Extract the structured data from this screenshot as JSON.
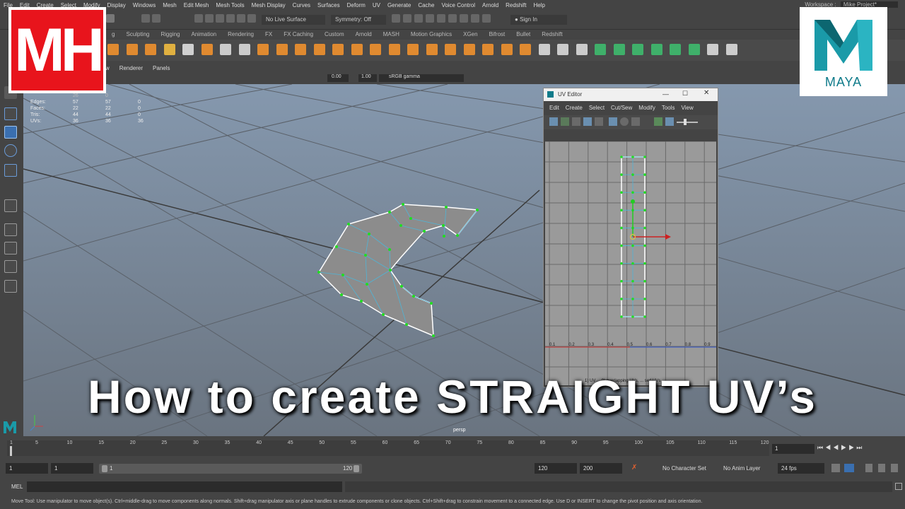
{
  "menubar": {
    "items": [
      "File",
      "Edit",
      "Create",
      "Select",
      "Modify",
      "Display",
      "Windows",
      "Mesh",
      "Edit Mesh",
      "Mesh Tools",
      "Mesh Display",
      "Curves",
      "Surfaces",
      "Deform",
      "UV",
      "Generate",
      "Cache",
      "Voice Control",
      "Arnold",
      "Redshift",
      "Help"
    ],
    "workspace_label": "Workspace :",
    "workspace_value": "Mike Project*"
  },
  "statusline": {
    "live_surface": "No Live Surface",
    "symmetry": "Symmetry: Off",
    "sign_in": "Sign In"
  },
  "shelf": {
    "tabs": [
      "g",
      "Sculpting",
      "Rigging",
      "Animation",
      "Rendering",
      "FX",
      "FX Caching",
      "Custom",
      "Arnold",
      "MASH",
      "Motion Graphics",
      "XGen",
      "Bifrost",
      "Bullet",
      "Redshift"
    ]
  },
  "panel": {
    "menu": [
      "how",
      "Renderer",
      "Panels"
    ],
    "camera_value_1": "0.00",
    "camera_value_2": "1.00",
    "color_space": "sRGB gamma",
    "camera_name": "persp"
  },
  "hud": {
    "rows": [
      {
        "label": "Edges:",
        "v1": "57",
        "v2": "57",
        "v3": "0"
      },
      {
        "label": "Faces:",
        "v1": "22",
        "v2": "22",
        "v3": "0"
      },
      {
        "label": "Tris:",
        "v1": "44",
        "v2": "44",
        "v3": "0"
      },
      {
        "label": "UVs:",
        "v1": "36",
        "v2": "36",
        "v3": "36"
      }
    ],
    "top_partial": [
      "26",
      "0"
    ]
  },
  "uv_editor": {
    "title": "UV Editor",
    "menu": [
      "Edit",
      "Create",
      "Select",
      "Cut/Sew",
      "Modify",
      "Tools",
      "View"
    ],
    "axis_labels": [
      "0.1",
      "0.2",
      "0.3",
      "0.4",
      "0.5",
      "0.6",
      "0.7",
      "0.8",
      "0.9"
    ],
    "status_text": "1) UV ... 0) overlapping UVs, ... sed UVs"
  },
  "logos": {
    "mh": "MH",
    "maya": "MAYA"
  },
  "overlay_title": "How to create STRAIGHT UV’s",
  "timeline": {
    "ticks": [
      "1",
      "5",
      "10",
      "15",
      "20",
      "25",
      "30",
      "35",
      "40",
      "45",
      "50",
      "55",
      "60",
      "65",
      "70",
      "75",
      "80",
      "85",
      "90",
      "95",
      "100",
      "105",
      "110",
      "115",
      "120"
    ],
    "current_frame": "1"
  },
  "range": {
    "start_field": "1",
    "start_inner": "1",
    "slider_start": "1",
    "slider_end": "120",
    "end_inner": "120",
    "end_field": "200",
    "character_set": "No Character Set",
    "anim_layer": "No Anim Layer",
    "fps": "24 fps"
  },
  "cmdline": {
    "label": "MEL",
    "help": "Move Tool: Use manipulator to move object(s). Ctrl+middle-drag to move components along normals. Shift+drag manipulator axis or plane handles to extrude components or clone objects. Ctrl+Shift+drag to constrain movement to a connected edge. Use D or INSERT to change the pivot position and axis orientation."
  },
  "colors": {
    "accent_red": "#e8141c",
    "maya_teal": "#0f7b8a",
    "uv_selected": "#ffffff",
    "vertex_green": "#22dd22"
  }
}
